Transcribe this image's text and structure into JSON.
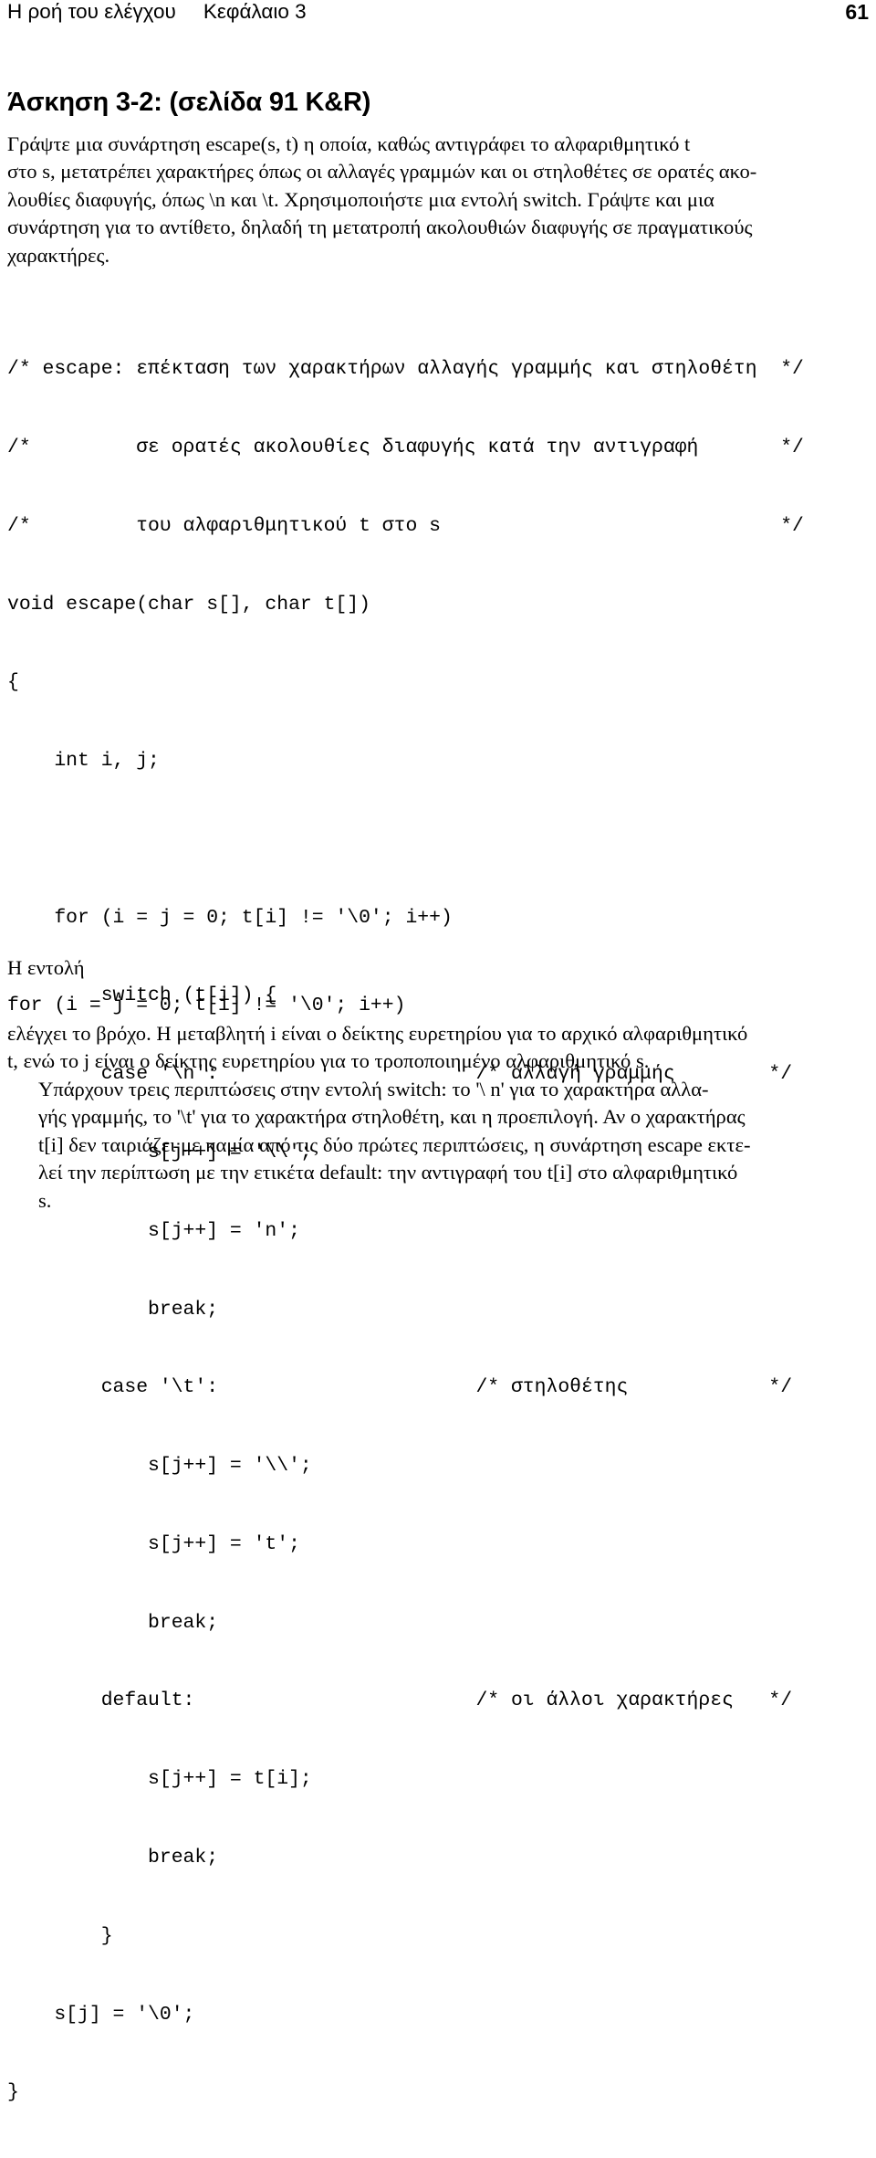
{
  "running_head": {
    "section_title": "Η ροή του ελέγχου",
    "chapter": "Κεφάλαιο 3",
    "page_number": "61"
  },
  "exercise": {
    "title": "Άσκηση 3-2: (σελίδα 91 K&R)"
  },
  "intro_paragraph": {
    "lines": [
      "Γράψτε μια συνάρτηση escape(s, t) η οποία, καθώς αντιγράφει το αλφαριθμητικό t",
      "στο s, μετατρέπει χαρακτήρες όπως οι αλλαγές γραμμών και οι στηλοθέτες σε ορατές ακο-",
      "λουθίες διαφυγής, όπως \\n και \\t. Χρησιμοποιήστε μια εντολή switch. Γράψτε και μια",
      "συνάρτηση για το αντίθετο, δηλαδή τη μετατροπή ακολουθιών διαφυγής σε πραγματικούς",
      "χαρακτήρες."
    ]
  },
  "code_listing": {
    "lines": [
      "/* escape: επέκταση των χαρακτήρων αλλαγής γραμμής και στηλοθέτη  */",
      "/*         σε ορατές ακολουθίες διαφυγής κατά την αντιγραφή       */",
      "/*         του αλφαριθμητικού t στο s                             */",
      "void escape(char s[], char t[])",
      "{",
      "    int i, j;",
      "",
      "    for (i = j = 0; t[i] != '\\0'; i++)",
      "        switch (t[i]) {",
      "        case '\\n':                      /* αλλαγή γραμμής        */",
      "            s[j++] = '\\\\';",
      "            s[j++] = 'n';",
      "            break;",
      "        case '\\t':                      /* στηλοθέτης            */",
      "            s[j++] = '\\\\';",
      "            s[j++] = 't';",
      "            break;",
      "        default:                        /* οι άλλοι χαρακτήρες   */",
      "            s[j++] = t[i];",
      "            break;",
      "        }",
      "    s[j] = '\\0';",
      "}"
    ]
  },
  "mid_text": {
    "label": "Η εντολή",
    "code_line": "for (i = j = 0; t[i] != '\\0'; i++)"
  },
  "tail_paragraph_1": {
    "lines": [
      "ελέγχει το βρόχο. Η μεταβλητή i είναι ο δείκτης ευρετηρίου για το αρχικό αλφαριθμητικό",
      "t, ενώ το j είναι ο δείκτης ευρετηρίου για το τροποποιημένο αλφαριθμητικό s."
    ]
  },
  "tail_paragraph_2": {
    "lines": [
      "Υπάρχουν τρεις περιπτώσεις στην εντολή switch: το '\\ n' για το χαρακτήρα αλλα-",
      "γής γραμμής, το '\\t' για το χαρακτήρα στηλοθέτη, και η προεπιλογή. Αν ο χαρακτήρας",
      "t[i] δεν ταιριάζει με καμία από τις δύο πρώτες περιπτώσεις, η συνάρτηση escape εκτε-",
      "λεί την περίπτωση με την ετικέτα default: την αντιγραφή του t[i] στο αλφαριθμητικό",
      "s."
    ]
  }
}
